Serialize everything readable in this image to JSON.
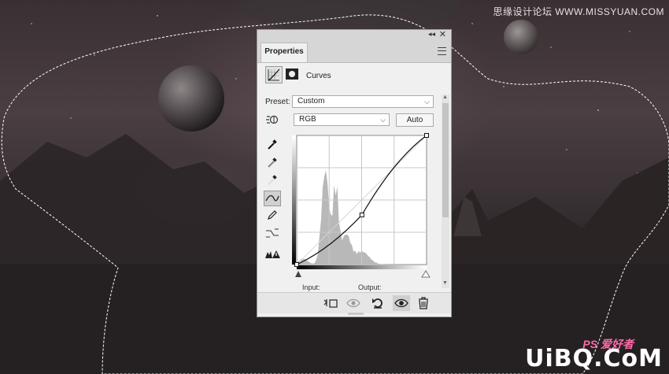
{
  "watermark": {
    "top_text": "思缘设计论坛 WWW.MISSYUAN.COM",
    "ps_text": "PS 爱好者",
    "site_text": "UiBQ.CoM"
  },
  "panel": {
    "tab_label": "Properties",
    "adjustment_title": "Curves",
    "preset_label": "Preset:",
    "preset_value": "Custom",
    "channel_value": "RGB",
    "auto_label": "Auto",
    "input_label": "Input:",
    "output_label": "Output:"
  },
  "icons": {
    "titlebar": [
      "collapse-icon",
      "close-icon",
      "panel-menu-icon"
    ],
    "header": [
      "curves-adjustment-icon",
      "layer-mask-icon"
    ],
    "tools": [
      "on-image-adjust-icon",
      "black-point-eyedropper-icon",
      "gray-point-eyedropper-icon",
      "white-point-eyedropper-icon",
      "curve-points-icon",
      "pencil-draw-icon",
      "smooth-curve-icon",
      "clipping-warning-icon"
    ],
    "bottom": [
      "clip-to-layer-icon",
      "view-previous-icon",
      "reset-icon",
      "visibility-eye-icon",
      "delete-trash-icon"
    ]
  },
  "chart_data": {
    "type": "line",
    "curve_points": [
      [
        0,
        0
      ],
      [
        128,
        98
      ],
      [
        255,
        255
      ]
    ],
    "xlim": [
      0,
      255
    ],
    "ylim": [
      0,
      255
    ],
    "grid": true
  }
}
